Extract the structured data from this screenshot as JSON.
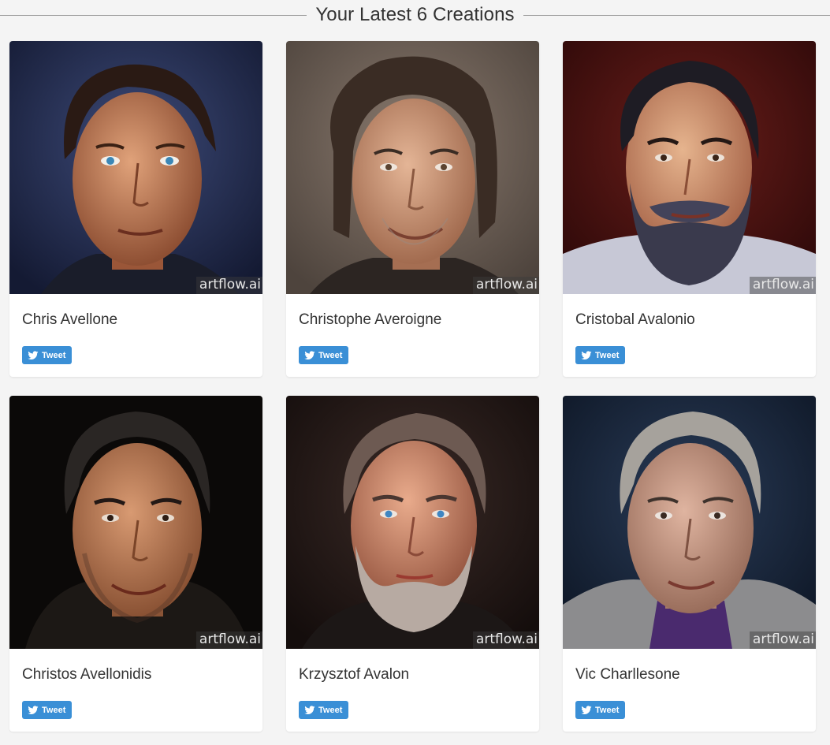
{
  "section": {
    "title": "Your Latest 6 Creations"
  },
  "watermark": "artflow.ai",
  "tweet_label": "Tweet",
  "cards": [
    {
      "name": "Chris Avellone"
    },
    {
      "name": "Christophe Averoigne"
    },
    {
      "name": "Cristobal Avalonio"
    },
    {
      "name": "Christos Avellonidis"
    },
    {
      "name": "Krzysztof Avalon"
    },
    {
      "name": "Vic Charllesone"
    }
  ],
  "colors": {
    "page_bg": "#f4f4f4",
    "card_bg": "#ffffff",
    "tweet_button": "#3a8fd6",
    "text": "#333333"
  }
}
